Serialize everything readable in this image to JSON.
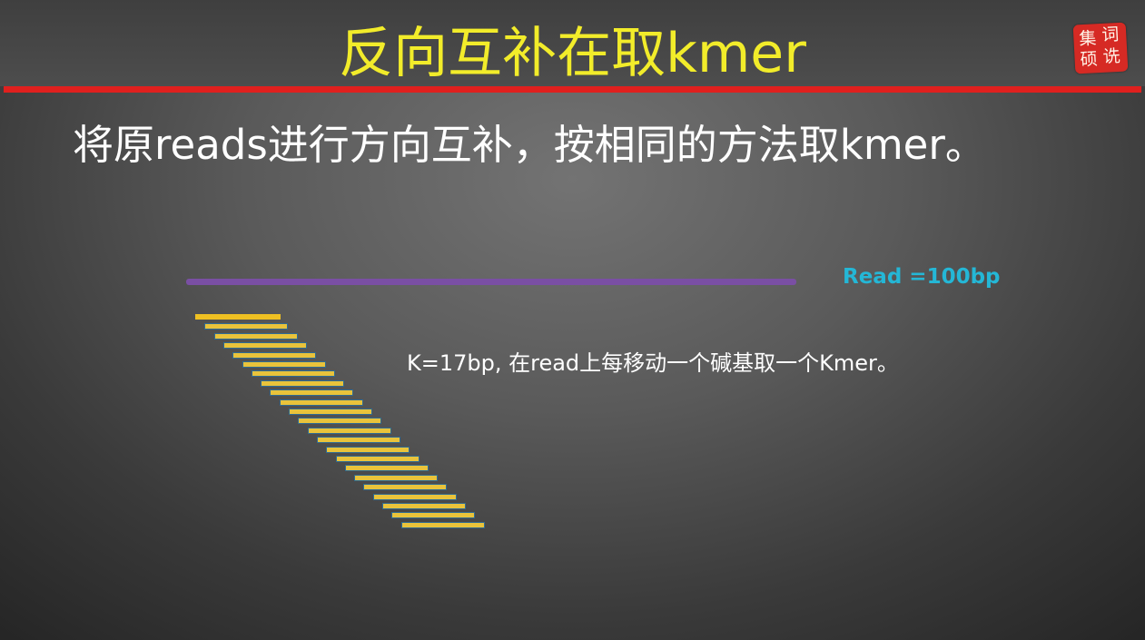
{
  "slide": {
    "title": "反向互补在取kmer",
    "body": "将原reads进行方向互补，按相同的方法取kmer。",
    "read_label": "Read =100bp",
    "kmer_note": "K=17bp, 在read上每移动一个碱基取一个Kmer。",
    "logo_chars": [
      "集",
      "词",
      "硕",
      "诜"
    ]
  },
  "diagram": {
    "read_color": "#7a4fa4",
    "kmer_color": "#efc022",
    "kmer_outline_color": "#2f6b93",
    "kmer_count": 23
  },
  "colors": {
    "title": "#f2ec2a",
    "rule": "#e0201e",
    "label": "#24b7d6",
    "text": "#ffffff"
  }
}
